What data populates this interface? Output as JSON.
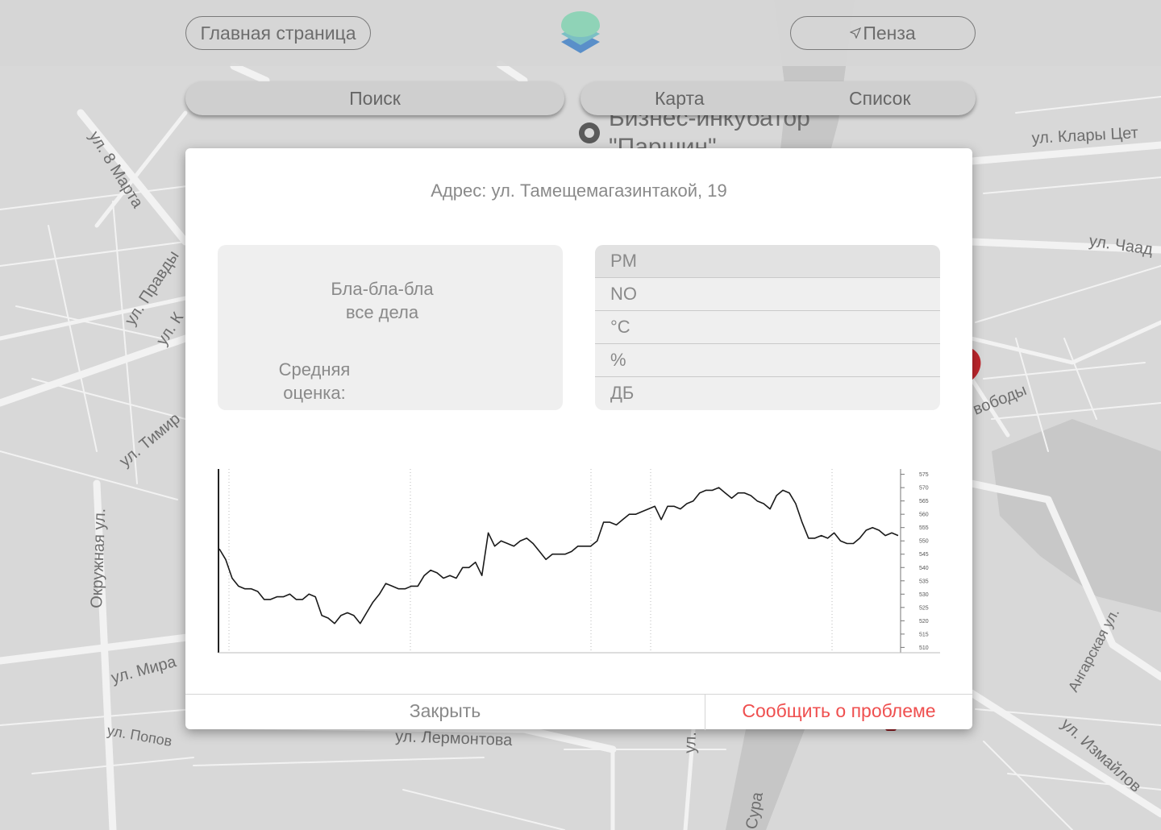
{
  "header": {
    "home_label": "Главная страница",
    "city_label": "Пенза"
  },
  "tabs": {
    "search_label": "Поиск",
    "map_label": "Карта",
    "list_label": "Список"
  },
  "map_labels": {
    "tr_label": "ул. Клары Цет",
    "chaad": "ул. Чаад",
    "svobody": "вободы",
    "biz_incubator_1": "Бизнес-инкубатор",
    "biz_incubator_2": "\"Паршин\"",
    "vosmoe_marta": "ул. 8 Марта",
    "pravdy": "ул. Правды",
    "ul_k": "ул. К",
    "timiryazeva": "ул. Тимир",
    "okruzhnaya": "Окружная ул.",
    "mira": "ул. Мира",
    "popova": "ул. Попов",
    "lermontova": "ул. Лермонтова",
    "sura": "Сура",
    "angarskaya": "Ангарская ул.",
    "izmailova": "ул. Измайлов",
    "ul_bottom": "ул."
  },
  "modal": {
    "address": "Адрес: ул. Тамещемагазинтакой, 19",
    "description_line1": "Бла-бла-бла",
    "description_line2": "все дела",
    "rating_line1": "Средняя",
    "rating_line2": "оценка:",
    "metrics": [
      "PM",
      "NO",
      "°C",
      "%",
      "ДБ"
    ],
    "close_label": "Закрыть",
    "report_label": "Сообщить о проблеме"
  },
  "colors": {
    "accent_red": "#ef4f4f",
    "modal_bg": "#ffffff",
    "card_bg": "#efefef",
    "logo_top": "#8fd3b7",
    "logo_mid": "#7bbfc4",
    "logo_bottom": "#5a8fc9"
  },
  "chart_data": {
    "type": "line",
    "title": "",
    "xlabel": "",
    "ylabel": "",
    "ylim": [
      508,
      577
    ],
    "yticks": [
      510,
      515,
      520,
      525,
      530,
      535,
      540,
      545,
      550,
      555,
      560,
      565,
      570,
      575
    ],
    "grid": "vertical dotted",
    "series": [
      {
        "values": [
          547,
          543,
          536,
          533,
          532,
          532,
          531,
          528,
          528,
          529,
          529,
          530,
          528,
          528,
          530,
          529,
          522,
          521,
          519,
          522,
          523,
          522,
          519,
          523,
          527,
          530,
          534,
          533,
          532,
          532,
          533,
          533,
          537,
          539,
          538,
          536,
          537,
          536,
          540,
          540,
          542,
          537,
          553,
          548,
          550,
          549,
          548,
          550,
          551,
          549,
          546,
          543,
          545,
          545,
          545,
          546,
          548,
          548,
          548,
          550,
          557,
          557,
          556,
          558,
          560,
          560,
          561,
          562,
          563,
          558,
          563,
          563,
          562,
          564,
          565,
          568,
          569,
          569,
          570,
          568,
          566,
          568,
          568,
          567,
          565,
          564,
          562,
          567,
          569,
          568,
          564,
          557,
          551,
          551,
          552,
          551,
          553,
          550,
          549,
          549,
          551,
          554,
          555,
          554,
          552,
          553,
          552
        ]
      }
    ]
  }
}
